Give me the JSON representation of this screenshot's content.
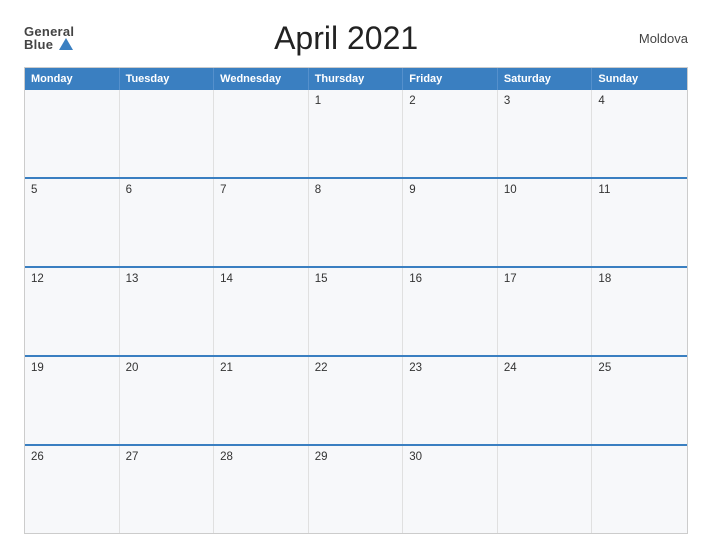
{
  "header": {
    "logo_general": "General",
    "logo_blue": "Blue",
    "title": "April 2021",
    "country": "Moldova"
  },
  "calendar": {
    "weekdays": [
      "Monday",
      "Tuesday",
      "Wednesday",
      "Thursday",
      "Friday",
      "Saturday",
      "Sunday"
    ],
    "weeks": [
      [
        {
          "day": "",
          "empty": true
        },
        {
          "day": "",
          "empty": true
        },
        {
          "day": "",
          "empty": true
        },
        {
          "day": "1",
          "empty": false
        },
        {
          "day": "2",
          "empty": false
        },
        {
          "day": "3",
          "empty": false
        },
        {
          "day": "4",
          "empty": false
        }
      ],
      [
        {
          "day": "5",
          "empty": false
        },
        {
          "day": "6",
          "empty": false
        },
        {
          "day": "7",
          "empty": false
        },
        {
          "day": "8",
          "empty": false
        },
        {
          "day": "9",
          "empty": false
        },
        {
          "day": "10",
          "empty": false
        },
        {
          "day": "11",
          "empty": false
        }
      ],
      [
        {
          "day": "12",
          "empty": false
        },
        {
          "day": "13",
          "empty": false
        },
        {
          "day": "14",
          "empty": false
        },
        {
          "day": "15",
          "empty": false
        },
        {
          "day": "16",
          "empty": false
        },
        {
          "day": "17",
          "empty": false
        },
        {
          "day": "18",
          "empty": false
        }
      ],
      [
        {
          "day": "19",
          "empty": false
        },
        {
          "day": "20",
          "empty": false
        },
        {
          "day": "21",
          "empty": false
        },
        {
          "day": "22",
          "empty": false
        },
        {
          "day": "23",
          "empty": false
        },
        {
          "day": "24",
          "empty": false
        },
        {
          "day": "25",
          "empty": false
        }
      ],
      [
        {
          "day": "26",
          "empty": false
        },
        {
          "day": "27",
          "empty": false
        },
        {
          "day": "28",
          "empty": false
        },
        {
          "day": "29",
          "empty": false
        },
        {
          "day": "30",
          "empty": false
        },
        {
          "day": "",
          "empty": true
        },
        {
          "day": "",
          "empty": true
        }
      ]
    ]
  }
}
